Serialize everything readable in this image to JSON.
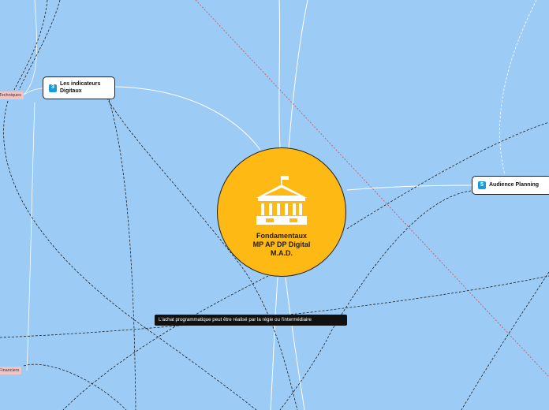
{
  "central": {
    "title_line1": "Fondamentaux",
    "title_line2": "MP AP DP  Digital",
    "title_line3": "M.A.D.",
    "icon": "bank-building-icon",
    "color": "#ffb914"
  },
  "nodes": {
    "indicateurs": {
      "badge": "3",
      "line1": "Les indicateurs",
      "line2": "Digitaux"
    },
    "audience": {
      "badge": "5",
      "label": "Audience Planning"
    }
  },
  "tags": {
    "techniques": "Techniques",
    "financiers": "Financiers"
  },
  "tooltip": {
    "text": "L'achat programmatique peut être réalisé par la régie ou l'intermédiaire"
  },
  "colors": {
    "background": "#9ccbf5",
    "badge": "#1a9bd7",
    "tag": "#f3c3c3",
    "dashed_red": "#c8505a"
  }
}
